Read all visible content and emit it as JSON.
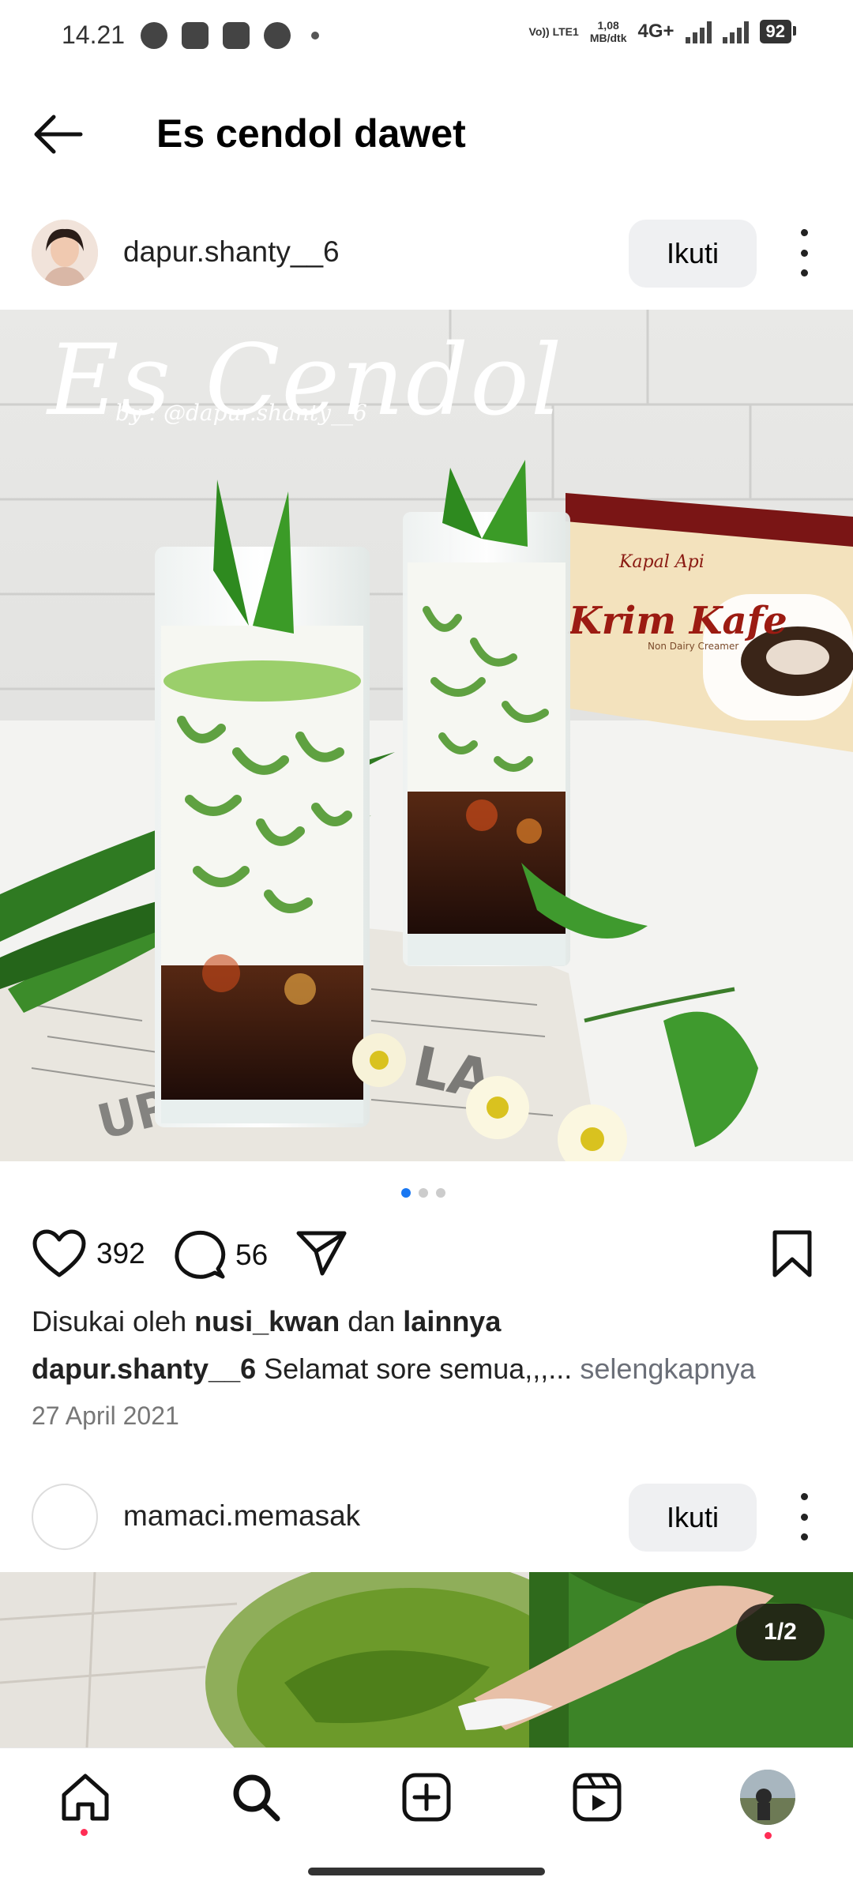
{
  "status_bar": {
    "time": "14.21",
    "volte": "Vo)) LTE1",
    "speed_value": "1,08",
    "speed_unit": "MB/dtk",
    "network": "4G+",
    "battery": "92"
  },
  "header": {
    "title": "Es cendol dawet"
  },
  "post1": {
    "username": "dapur.shanty__6",
    "follow_label": "Ikuti",
    "image_overlay_title": "Es Cendol",
    "image_overlay_sub": "by : @dapur.shanty__6",
    "box_brand": "Krim Kafe",
    "box_logo": "Kapal Api",
    "box_sub": "Non Dairy Creamer",
    "likes_count": "392",
    "comments_count": "56",
    "liked_prefix": "Disukai oleh",
    "liked_user": "nusi_kwan",
    "liked_and": "dan",
    "liked_others": "lainnya",
    "caption_user": "dapur.shanty__6",
    "caption_text": "Selamat sore semua,,,...",
    "caption_more": "selengkapnya",
    "date": "27 April 2021"
  },
  "post2": {
    "username": "mamaci.memasak",
    "follow_label": "Ikuti",
    "counter": "1/2"
  },
  "carousel": {
    "total": 3,
    "active": 1
  },
  "colors": {
    "accent": "#1877f2",
    "notif": "#ff2d55",
    "button_bg": "#eff0f2"
  },
  "icons": [
    "back-arrow-icon",
    "heart-icon",
    "comment-icon",
    "share-icon",
    "bookmark-icon",
    "home-icon",
    "search-icon",
    "add-icon",
    "reels-icon",
    "profile-icon",
    "more-icon"
  ]
}
